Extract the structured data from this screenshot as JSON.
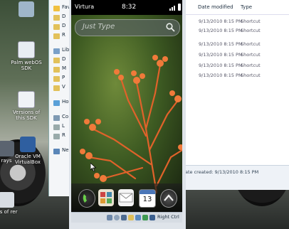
{
  "desktop": {
    "icons": [
      {
        "label": "",
        "name": "recycle-bin-icon"
      },
      {
        "label": "Palm webOS SDK",
        "name": "webos-sdk-icon"
      },
      {
        "label": "Versions of this SDK",
        "name": "sdk-versions-icon"
      },
      {
        "label": "Oracle VM VirtualBox",
        "name": "virtualbox-icon"
      },
      {
        "label": "rays",
        "name": "rays-icon"
      },
      {
        "label": "els of rer",
        "name": "shortcut-icon"
      }
    ]
  },
  "explorer_back": {
    "items": [
      "Fav",
      "D",
      "D",
      "R",
      "Libr",
      "D",
      "M",
      "P",
      "V",
      "Ho",
      "Co",
      "L",
      "R",
      "Ne"
    ]
  },
  "explorer_front": {
    "columns": [
      "Date modified",
      "Type"
    ],
    "rows": [
      {
        "date": "9/13/2010 8:15 PM",
        "type": "Shortcut"
      },
      {
        "date": "9/13/2010 8:15 PM",
        "type": "Shortcut"
      },
      {
        "date": "9/13/2010 8:15 PM",
        "type": "Shortcut"
      },
      {
        "date": "9/13/2010 8:15 PM",
        "type": "Shortcut"
      },
      {
        "date": "9/13/2010 8:15 PM",
        "type": "Shortcut"
      },
      {
        "date": "9/13/2010 8:15 PM",
        "type": "Shortcut"
      }
    ],
    "details": "ate created: 9/13/2010 8:15 PM"
  },
  "phone": {
    "carrier": "Virtura",
    "time": "8:32",
    "search_placeholder": "Just Type",
    "calendar_day": "13"
  },
  "taskbar": {
    "right_ctrl": "Right Ctrl"
  }
}
